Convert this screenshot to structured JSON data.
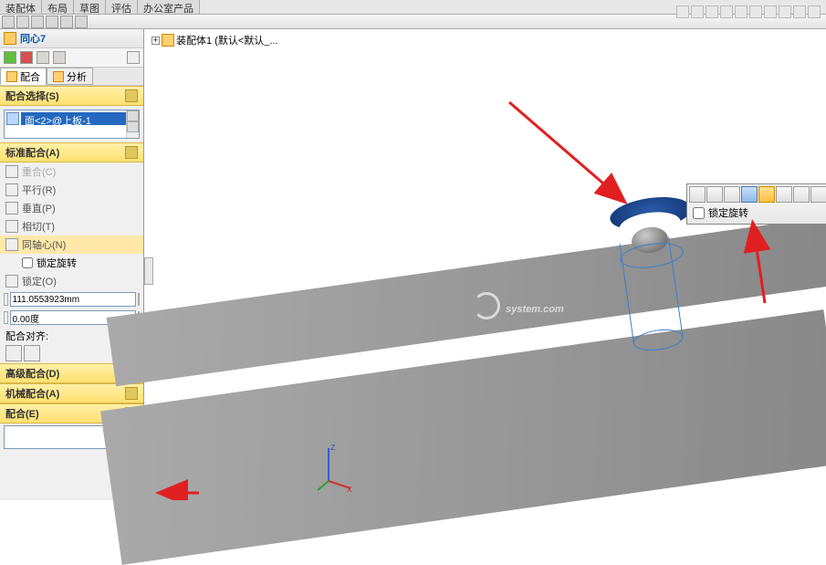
{
  "tabs": {
    "t0": "装配体",
    "t1": "布局",
    "t2": "草图",
    "t3": "评估",
    "t4": "办公室产品"
  },
  "feature": {
    "name": "同心7"
  },
  "mate_tabs": {
    "mate": "配合",
    "analysis": "分析"
  },
  "sections": {
    "selection": "配合选择(S)",
    "standard": "标准配合(A)",
    "advanced": "高级配合(D)",
    "mechanical": "机械配合(A)",
    "mates": "配合(E)"
  },
  "selection_item": "面<2>@上板-1",
  "std_mates": {
    "coincident": "重合(C)",
    "parallel": "平行(R)",
    "perpendicular": "垂直(P)",
    "tangent": "相切(T)",
    "concentric": "同轴心(N)",
    "lock_rotation": "锁定旋转",
    "lock": "锁定(O)"
  },
  "dims": {
    "distance": "111.0553923mm",
    "angle": "0.00度"
  },
  "align_label": "配合对齐:",
  "tree": {
    "root": "装配体1 (默认<默认_..."
  },
  "ctx_checkbox": "锁定旋转",
  "watermark": "system.com"
}
